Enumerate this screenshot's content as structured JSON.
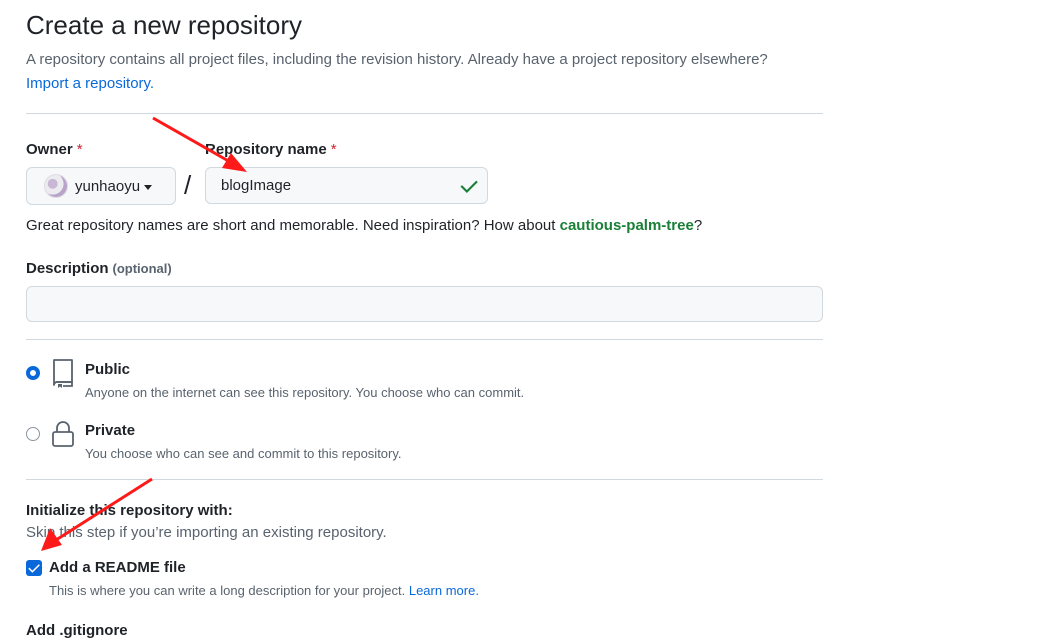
{
  "page": {
    "title": "Create a new repository",
    "lead_text": "A repository contains all project files, including the revision history. Already have a project repository elsewhere?",
    "import_link": "Import a repository."
  },
  "owner": {
    "label": "Owner",
    "required_mark": "*",
    "value": "yunhaoyu"
  },
  "repo_name": {
    "label": "Repository name",
    "required_mark": "*",
    "value": "blogImage",
    "separator": "/"
  },
  "hint": {
    "prefix": "Great repository names are short and memorable. Need inspiration? How about ",
    "suggestion": "cautious-palm-tree",
    "suffix": "?"
  },
  "description": {
    "label": "Description",
    "optional": "(optional)",
    "value": ""
  },
  "visibility": {
    "selected": "public",
    "public": {
      "title": "Public",
      "desc": "Anyone on the internet can see this repository. You choose who can commit."
    },
    "private": {
      "title": "Private",
      "desc": "You choose who can see and commit to this repository."
    }
  },
  "init": {
    "title": "Initialize this repository with:",
    "subtitle": "Skip this step if you’re importing an existing repository.",
    "readme": {
      "label": "Add a README file",
      "checked": true,
      "desc": "This is where you can write a long description for your project.",
      "learn_more": "Learn more."
    },
    "next_label": "Add .gitignore"
  },
  "colors": {
    "accent": "#0969da",
    "success": "#1a7f37",
    "danger": "#cf222e",
    "annotation_arrow": "#ff1a1a"
  }
}
